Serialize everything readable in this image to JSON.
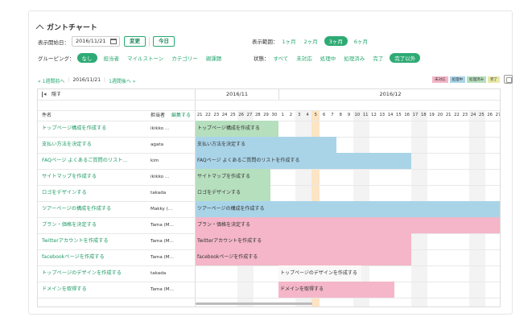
{
  "title": "ガントチャート",
  "controls": {
    "start_label": "表示開始日：",
    "start_date": "2016/11/21",
    "change_btn": "変更",
    "today_btn": "今日",
    "range_label": "表示範囲：",
    "ranges": [
      "1ヶ月",
      "2ヶ月",
      "3ヶ月",
      "6ヶ月"
    ],
    "range_selected": "3ヶ月",
    "group_label": "グルーピング：",
    "groups": [
      "なし",
      "担当者",
      "マイルストーン",
      "カテゴリー",
      "親課題"
    ],
    "group_selected": "なし",
    "status_label": "状態：",
    "statuses": [
      "すべて",
      "未対応",
      "処理中",
      "処理済み",
      "完了",
      "完了以外"
    ],
    "status_selected": "完了以外"
  },
  "nav": {
    "prev": "« 1週間前へ",
    "current": "2016/11/21",
    "next": "1週間後へ »"
  },
  "legend": [
    {
      "label": "未対応",
      "color": "#f4b6c8"
    },
    {
      "label": "処理中",
      "color": "#a9d4e8"
    },
    {
      "label": "処理済み",
      "color": "#b6dfbe"
    },
    {
      "label": "完了",
      "color": "#e9e9a8"
    }
  ],
  "grid": {
    "hide_label": "隠す",
    "col_name": "件名",
    "col_assignee": "担当者",
    "col_edit": "編集する",
    "months": [
      "2016/11",
      "2016/12"
    ],
    "days": [
      "21",
      "22",
      "23",
      "24",
      "25",
      "26",
      "27",
      "28",
      "29",
      "30",
      "1",
      "2",
      "3",
      "4",
      "5",
      "6",
      "7",
      "8",
      "9",
      "10",
      "11",
      "12",
      "13",
      "14",
      "15",
      "16",
      "17",
      "18",
      "19",
      "20",
      "21",
      "22",
      "23",
      "24",
      "25",
      "26",
      "27"
    ],
    "weekend_idx": [
      5,
      6,
      12,
      13,
      19,
      20,
      26,
      27,
      33,
      34
    ],
    "today_idx": 14
  },
  "tasks": [
    {
      "name": "トップページ構成を作成する",
      "assignee": "ikikko ...",
      "bar": "トップページ構成を作成する",
      "start": 0,
      "len": 10,
      "color": "#b6dfbe"
    },
    {
      "name": "支払い方法を決定する",
      "assignee": "agata",
      "bar": "支払い方法を決定する",
      "start": 0,
      "len": 17,
      "color": "#a9d4e8"
    },
    {
      "name": "FAQページ よくあるご質問のリスト...",
      "assignee": "kim",
      "bar": "FAQページ よくあるご質問のリストを作成する",
      "start": 0,
      "len": 26,
      "color": "#a9d4e8"
    },
    {
      "name": "サイトマップを作成する",
      "assignee": "ikikko ...",
      "bar": "サイトマップを作成する",
      "start": 0,
      "len": 9,
      "color": "#b6dfbe"
    },
    {
      "name": "ロゴをデザインする",
      "assignee": "takada",
      "bar": "ロゴをデザインする",
      "start": 0,
      "len": 9,
      "color": "#b6dfbe"
    },
    {
      "name": "ツアーページの構成を作成する",
      "assignee": "Makky (...",
      "bar": "ツアーページの構成を作成する",
      "start": 0,
      "len": 37,
      "color": "#a9d4e8"
    },
    {
      "name": "プラン・価格を決定する",
      "assignee": "Tama (M...",
      "bar": "プラン・価格を決定する",
      "start": 0,
      "len": 37,
      "color": "#f4b6c8"
    },
    {
      "name": "Twitterアカウントを作成する",
      "assignee": "Tama (M...",
      "bar": "Twitterアカウントを作成する",
      "start": 0,
      "len": 26,
      "color": "#f4b6c8"
    },
    {
      "name": "facebookページを作成する",
      "assignee": "Tama (M...",
      "bar": "facebookページを作成する",
      "start": 0,
      "len": 26,
      "color": "#f4b6c8"
    },
    {
      "name": "トップページのデザインを作成する",
      "assignee": "takada",
      "bar": "トップページのデザインを作成する",
      "start": 10,
      "len": 10,
      "color": "#f9f9f9"
    },
    {
      "name": "ドメインを取得する",
      "assignee": "Tama (M...",
      "bar": "ドメインを取得する",
      "start": 10,
      "len": 14,
      "color": "#f4b6c8"
    }
  ]
}
